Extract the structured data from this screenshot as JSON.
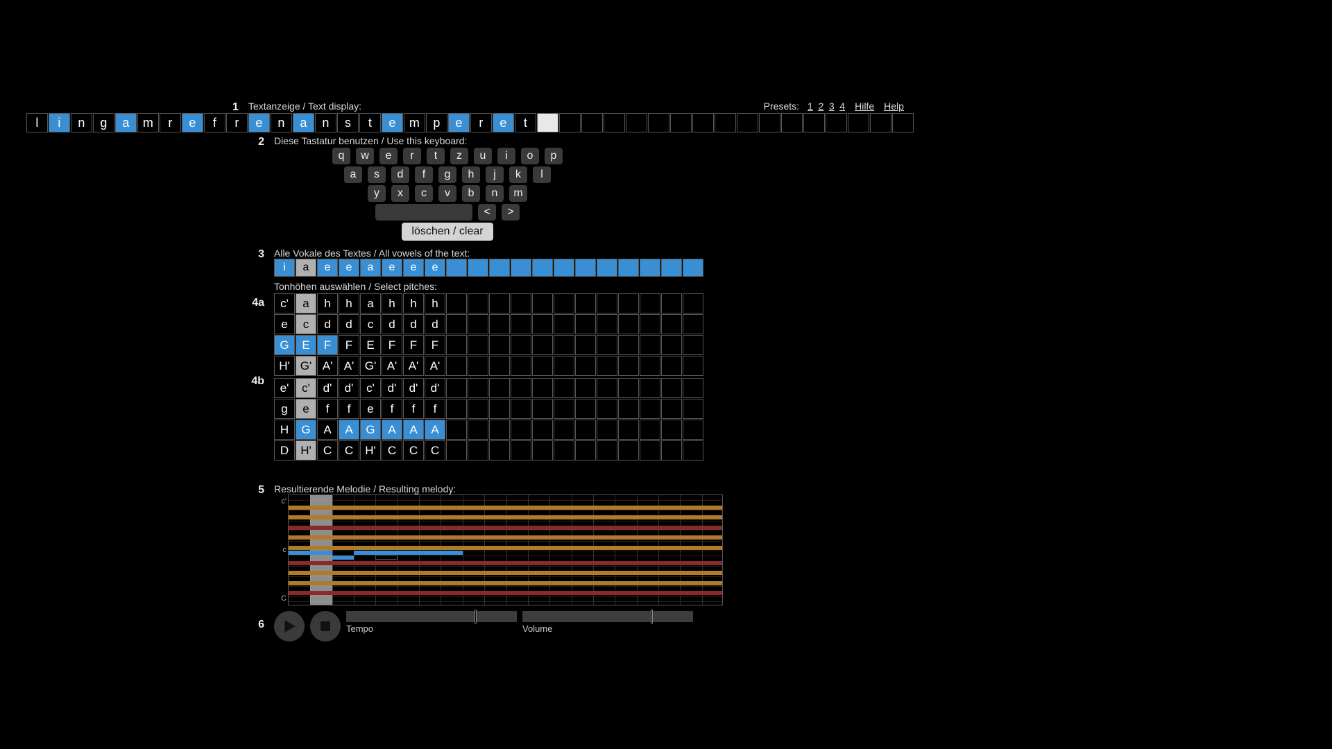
{
  "section1": {
    "step": "1",
    "label": "Textanzeige / Text display:",
    "presets_label": "Presets:",
    "presets": [
      "1",
      "2",
      "3",
      "4"
    ],
    "hilfe": "Hilfe",
    "help": "Help",
    "total_cells": 40,
    "cursor_index": 23,
    "letters": [
      "l",
      "i",
      "n",
      "g",
      "a",
      "m",
      "r",
      "e",
      "f",
      "r",
      "e",
      "n",
      "a",
      "n",
      "s",
      "t",
      "e",
      "m",
      "p",
      "e",
      "r",
      "e",
      "t"
    ],
    "vowel_indices": [
      1,
      4,
      7,
      10,
      12,
      16,
      19,
      21
    ]
  },
  "section2": {
    "step": "2",
    "label": "Diese Tastatur benutzen / Use this keyboard:",
    "rows": [
      [
        "q",
        "w",
        "e",
        "r",
        "t",
        "z",
        "u",
        "i",
        "o",
        "p"
      ],
      [
        "a",
        "s",
        "d",
        "f",
        "g",
        "h",
        "j",
        "k",
        "l"
      ],
      [
        "y",
        "x",
        "c",
        "v",
        "b",
        "n",
        "m"
      ]
    ],
    "left_arrow": "<",
    "right_arrow": ">",
    "clear": "löschen / clear"
  },
  "section3": {
    "step": "3",
    "label": "Alle Vokale des Textes / All vowels of the text:",
    "total_cells": 20,
    "vowels": [
      "i",
      "a",
      "e",
      "e",
      "a",
      "e",
      "e",
      "e"
    ],
    "grey_index": 1
  },
  "section4": {
    "label": "Tonhöhen auswählen / Select pitches:",
    "step_a": "4a",
    "step_b": "4b",
    "total_cols": 20,
    "block_a": {
      "rows": [
        [
          "c'",
          "a",
          "h",
          "h",
          "a",
          "h",
          "h",
          "h"
        ],
        [
          "e",
          "c",
          "d",
          "d",
          "c",
          "d",
          "d",
          "d"
        ],
        [
          "G",
          "E",
          "F",
          "F",
          "E",
          "F",
          "F",
          "F"
        ],
        [
          "H'",
          "G'",
          "A'",
          "A'",
          "G'",
          "A'",
          "A'",
          "A'"
        ]
      ],
      "blue_row_index": 2,
      "blue_cols": [
        0,
        1,
        2
      ],
      "grey_col": 1
    },
    "block_b": {
      "rows": [
        [
          "e'",
          "c'",
          "d'",
          "d'",
          "c'",
          "d'",
          "d'",
          "d'"
        ],
        [
          "g",
          "e",
          "f",
          "f",
          "e",
          "f",
          "f",
          "f"
        ],
        [
          "H",
          "G",
          "A",
          "A",
          "G",
          "A",
          "A",
          "A"
        ],
        [
          "D",
          "H'",
          "C",
          "C",
          "H'",
          "C",
          "C",
          "C"
        ]
      ],
      "blue_row_index": 2,
      "blue_cols": [
        1,
        3,
        4,
        5,
        6,
        7
      ],
      "grey_col": 1
    }
  },
  "section5": {
    "step": "5",
    "label": "Resultierende Melodie / Resulting melody:",
    "yaxis": [
      "c'",
      "c",
      "C"
    ],
    "cols": 20,
    "cursor_col": 1,
    "bands": [
      {
        "color": "orange",
        "row": 2,
        "start": 0,
        "end": 20
      },
      {
        "color": "orange",
        "row": 4,
        "start": 0,
        "end": 20
      },
      {
        "color": "red",
        "row": 6,
        "start": 0,
        "end": 20
      },
      {
        "color": "orange",
        "row": 8,
        "start": 0,
        "end": 20
      },
      {
        "color": "orange",
        "row": 10,
        "start": 0,
        "end": 20
      },
      {
        "color": "red",
        "row": 13,
        "start": 0,
        "end": 20
      },
      {
        "color": "orange",
        "row": 15,
        "start": 0,
        "end": 20
      },
      {
        "color": "orange",
        "row": 17,
        "start": 0,
        "end": 20
      },
      {
        "color": "red",
        "row": 19,
        "start": 0,
        "end": 20
      },
      {
        "color": "blue",
        "row": 11,
        "start": 0,
        "end": 2
      },
      {
        "color": "blue",
        "row": 12,
        "start": 2,
        "end": 3
      },
      {
        "color": "black",
        "row": 11,
        "start": 3,
        "end": 4
      },
      {
        "color": "blue",
        "row": 11,
        "start": 3,
        "end": 8
      },
      {
        "color": "black",
        "row": 12,
        "start": 4,
        "end": 5
      }
    ]
  },
  "section6": {
    "step": "6",
    "tempo_label": "Tempo",
    "volume_label": "Volume",
    "tempo_value": 0.77,
    "volume_value": 0.77
  }
}
